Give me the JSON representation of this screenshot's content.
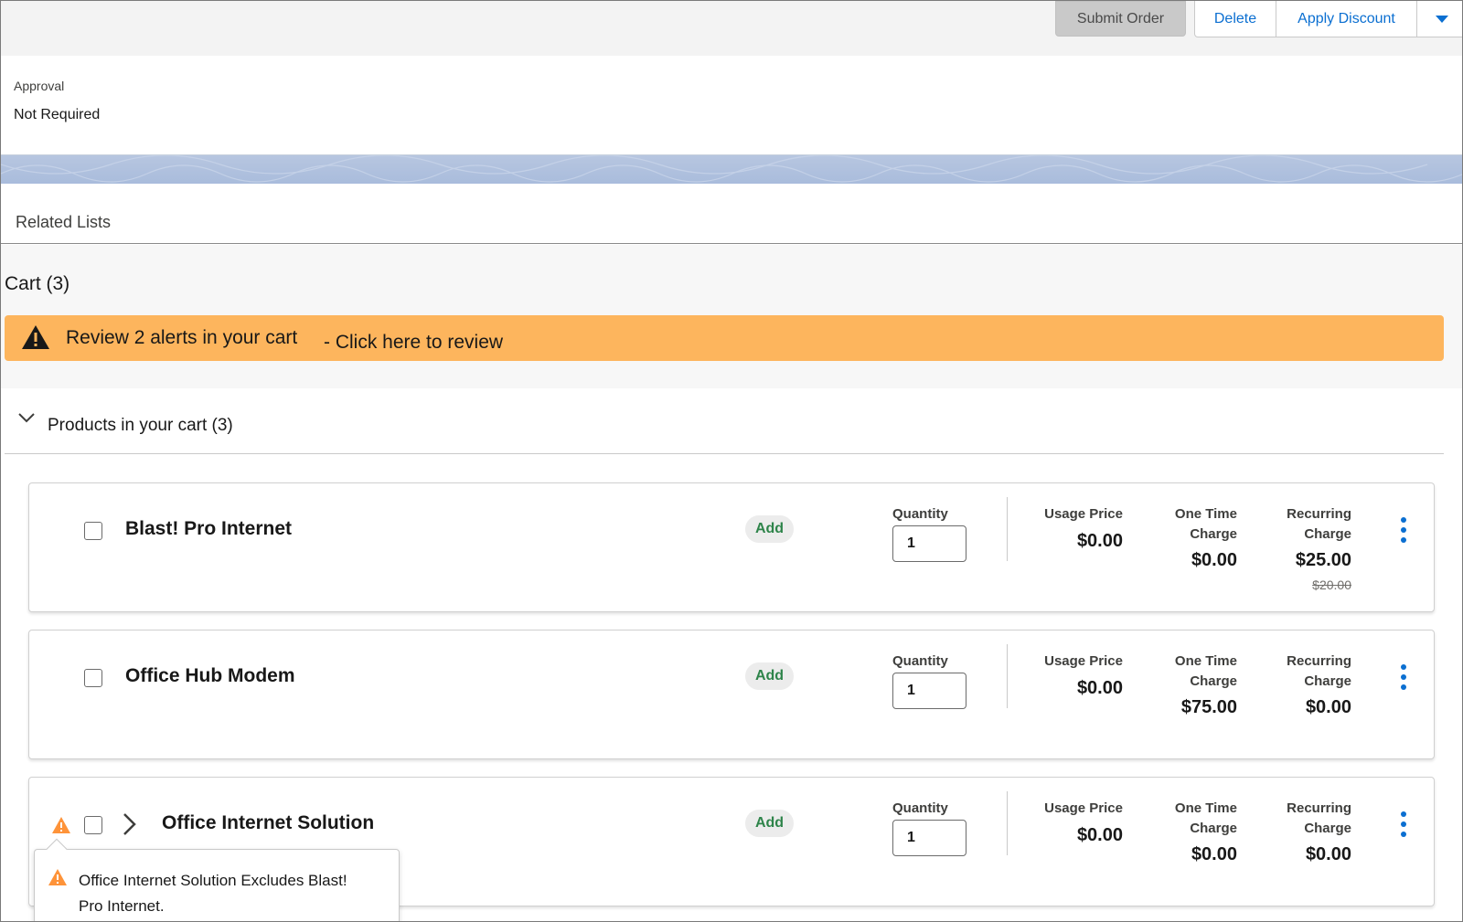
{
  "toolbar": {
    "submit_label": "Submit Order",
    "delete_label": "Delete",
    "discount_label": "Apply Discount"
  },
  "approval": {
    "label": "Approval",
    "value": "Not Required"
  },
  "related": {
    "title": "Related Lists"
  },
  "cart": {
    "title": "Cart (3)",
    "alert_text": "Review 2 alerts in your cart",
    "alert_link": "- Click here to review",
    "alert_color": "#fdb55d",
    "products_title": "Products in your cart (3)",
    "items": [
      {
        "name": "Blast! Pro Internet",
        "add_label": "Add",
        "qty_label": "Quantity",
        "qty": "1",
        "usage_label": "Usage Price",
        "usage": "$0.00",
        "one_time_label_1": "One Time",
        "one_time_label_2": "Charge",
        "one_time": "$0.00",
        "recurring_label_1": "Recurring",
        "recurring_label_2": "Charge",
        "recurring": "$25.00",
        "recurring_original": "$20.00"
      },
      {
        "name": "Office Hub Modem",
        "add_label": "Add",
        "qty_label": "Quantity",
        "qty": "1",
        "usage_label": "Usage Price",
        "usage": "$0.00",
        "one_time_label_1": "One Time",
        "one_time_label_2": "Charge",
        "one_time": "$75.00",
        "recurring_label_1": "Recurring",
        "recurring_label_2": "Charge",
        "recurring": "$0.00"
      },
      {
        "name": "Office Internet Solution",
        "add_label": "Add",
        "qty_label": "Quantity",
        "qty": "1",
        "usage_label": "Usage Price",
        "usage": "$0.00",
        "one_time_label_1": "One Time",
        "one_time_label_2": "Charge",
        "one_time": "$0.00",
        "recurring_label_1": "Recurring",
        "recurring_label_2": "Charge",
        "recurring": "$0.00"
      }
    ]
  },
  "popover": {
    "text": "Office Internet Solution Excludes Blast! Pro Internet."
  },
  "colors": {
    "link_blue": "#0b6fd1",
    "add_green": "#2e844a",
    "warning_orange": "#fe9339"
  }
}
